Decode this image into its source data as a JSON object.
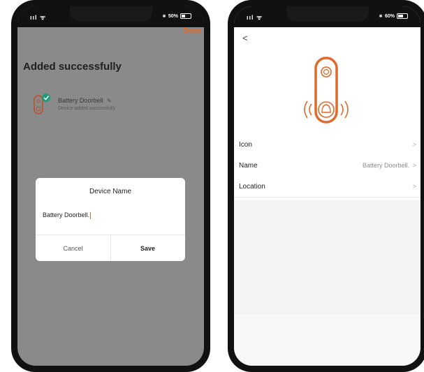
{
  "left_screen": {
    "done_label": "Done",
    "title": "Added successfully",
    "device": {
      "name": "Battery Doorbell",
      "status": "Device added successfully"
    },
    "dialog": {
      "title": "Device Name",
      "input_value": "Battery Doorbell.",
      "cancel_label": "Cancel",
      "save_label": "Save"
    },
    "status_bar": {
      "battery_text": "50%"
    }
  },
  "right_screen": {
    "back_symbol": "<",
    "rows": [
      {
        "label": "Icon",
        "value": ""
      },
      {
        "label": "Name",
        "value": "Battery Doorbell."
      },
      {
        "label": "Location",
        "value": ""
      }
    ],
    "chevron": ">",
    "status_bar": {
      "battery_text": "60%"
    }
  },
  "colors": {
    "accent": "#e06a2a",
    "success": "#1f9a7a"
  }
}
